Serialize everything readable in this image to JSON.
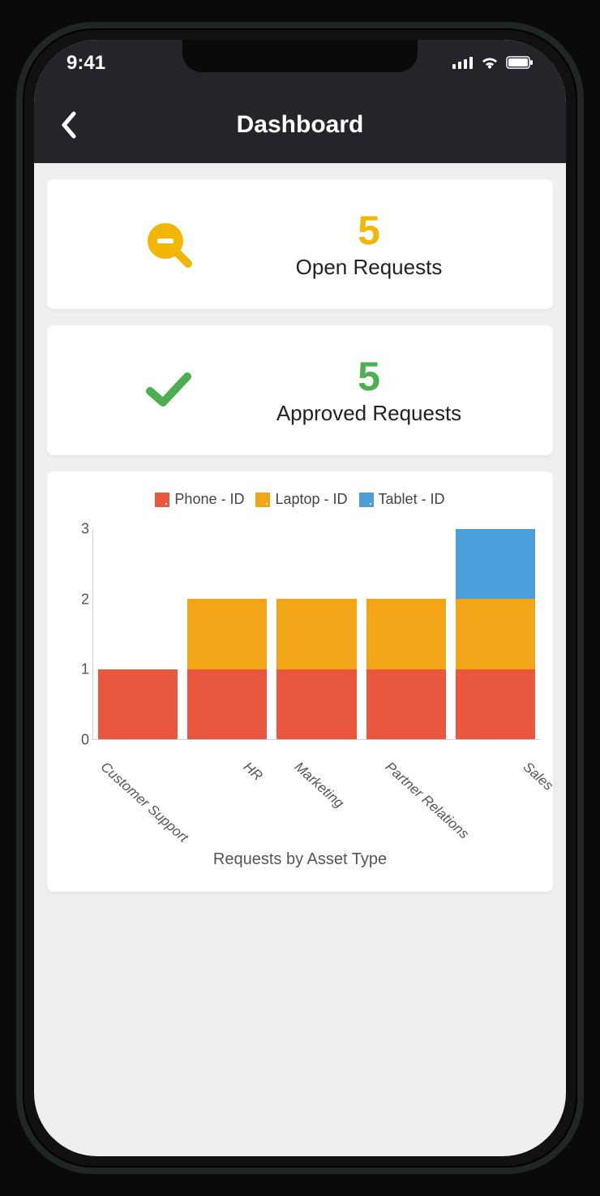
{
  "status": {
    "time": "9:41"
  },
  "navbar": {
    "title": "Dashboard"
  },
  "cards": {
    "open": {
      "value": "5",
      "label": "Open Requests"
    },
    "approved": {
      "value": "5",
      "label": "Approved Requests"
    }
  },
  "chart_data": {
    "type": "bar",
    "title": "Requests by Asset Type",
    "xlabel": "",
    "ylabel": "",
    "ylim": [
      0,
      3
    ],
    "yticks": [
      0,
      1,
      2,
      3
    ],
    "categories": [
      "Customer Support",
      "HR",
      "Marketing",
      "Partner Relations",
      "Sales"
    ],
    "series": [
      {
        "name": "Phone - ID",
        "color": "#e9573f",
        "values": [
          1,
          1,
          1,
          1,
          1
        ]
      },
      {
        "name": "Laptop - ID",
        "color": "#f2a516",
        "values": [
          0,
          1,
          1,
          1,
          1
        ]
      },
      {
        "name": "Tablet - ID",
        "color": "#4a9eda",
        "values": [
          0,
          0,
          0,
          0,
          1
        ]
      }
    ]
  }
}
